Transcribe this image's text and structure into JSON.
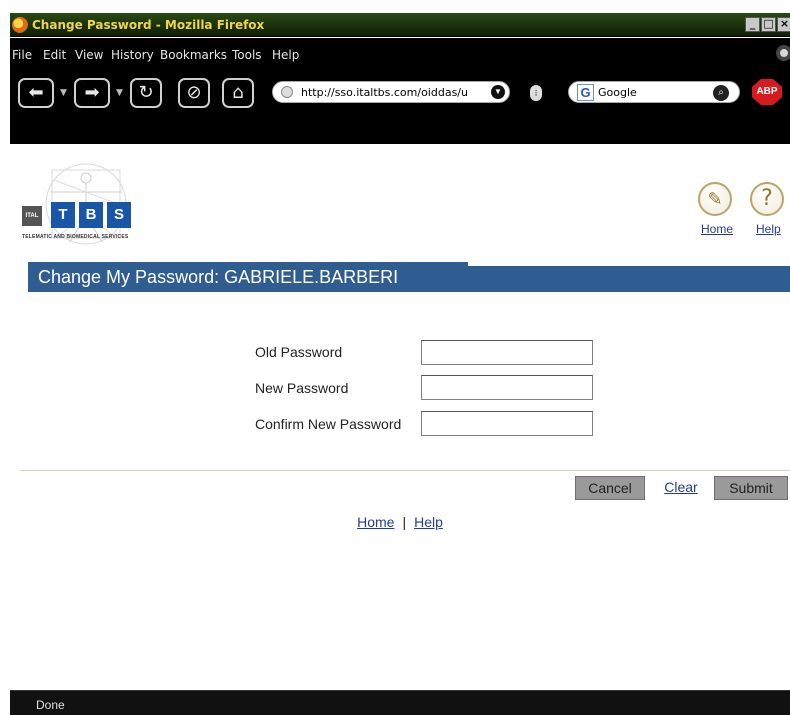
{
  "window": {
    "title": "Change Password - Mozilla Firefox",
    "controls": [
      "_",
      "□",
      "×"
    ]
  },
  "menu": [
    "File",
    "Edit",
    "View",
    "History",
    "Bookmarks",
    "Tools",
    "Help"
  ],
  "toolbar": {
    "back_icon": "back-arrow-icon",
    "forward_icon": "forward-arrow-icon",
    "reload_icon": "reload-icon",
    "stop_icon": "stop-icon",
    "home_icon": "home-icon",
    "url": "http://sso.italtbs.com/oiddas/u",
    "search_engine": "Google",
    "adblock_label": "ABP"
  },
  "logo": {
    "ital": "ITAL",
    "letters": [
      "T",
      "B",
      "S"
    ],
    "tagline": "TELEMATIC AND BIOMEDICAL SERVICES"
  },
  "header_links": {
    "home": "Home",
    "help": "Help"
  },
  "banner": {
    "title": "Change My Password: GABRIELE.BARBERI"
  },
  "form": {
    "old_password_label": "Old Password",
    "new_password_label": "New Password",
    "confirm_password_label": "Confirm New Password",
    "old_password_value": "",
    "new_password_value": "",
    "confirm_password_value": ""
  },
  "actions": {
    "cancel": "Cancel",
    "clear": "Clear",
    "submit": "Submit"
  },
  "footer": {
    "home": "Home",
    "separator": "|",
    "help": "Help"
  },
  "status": {
    "text": "Done"
  }
}
